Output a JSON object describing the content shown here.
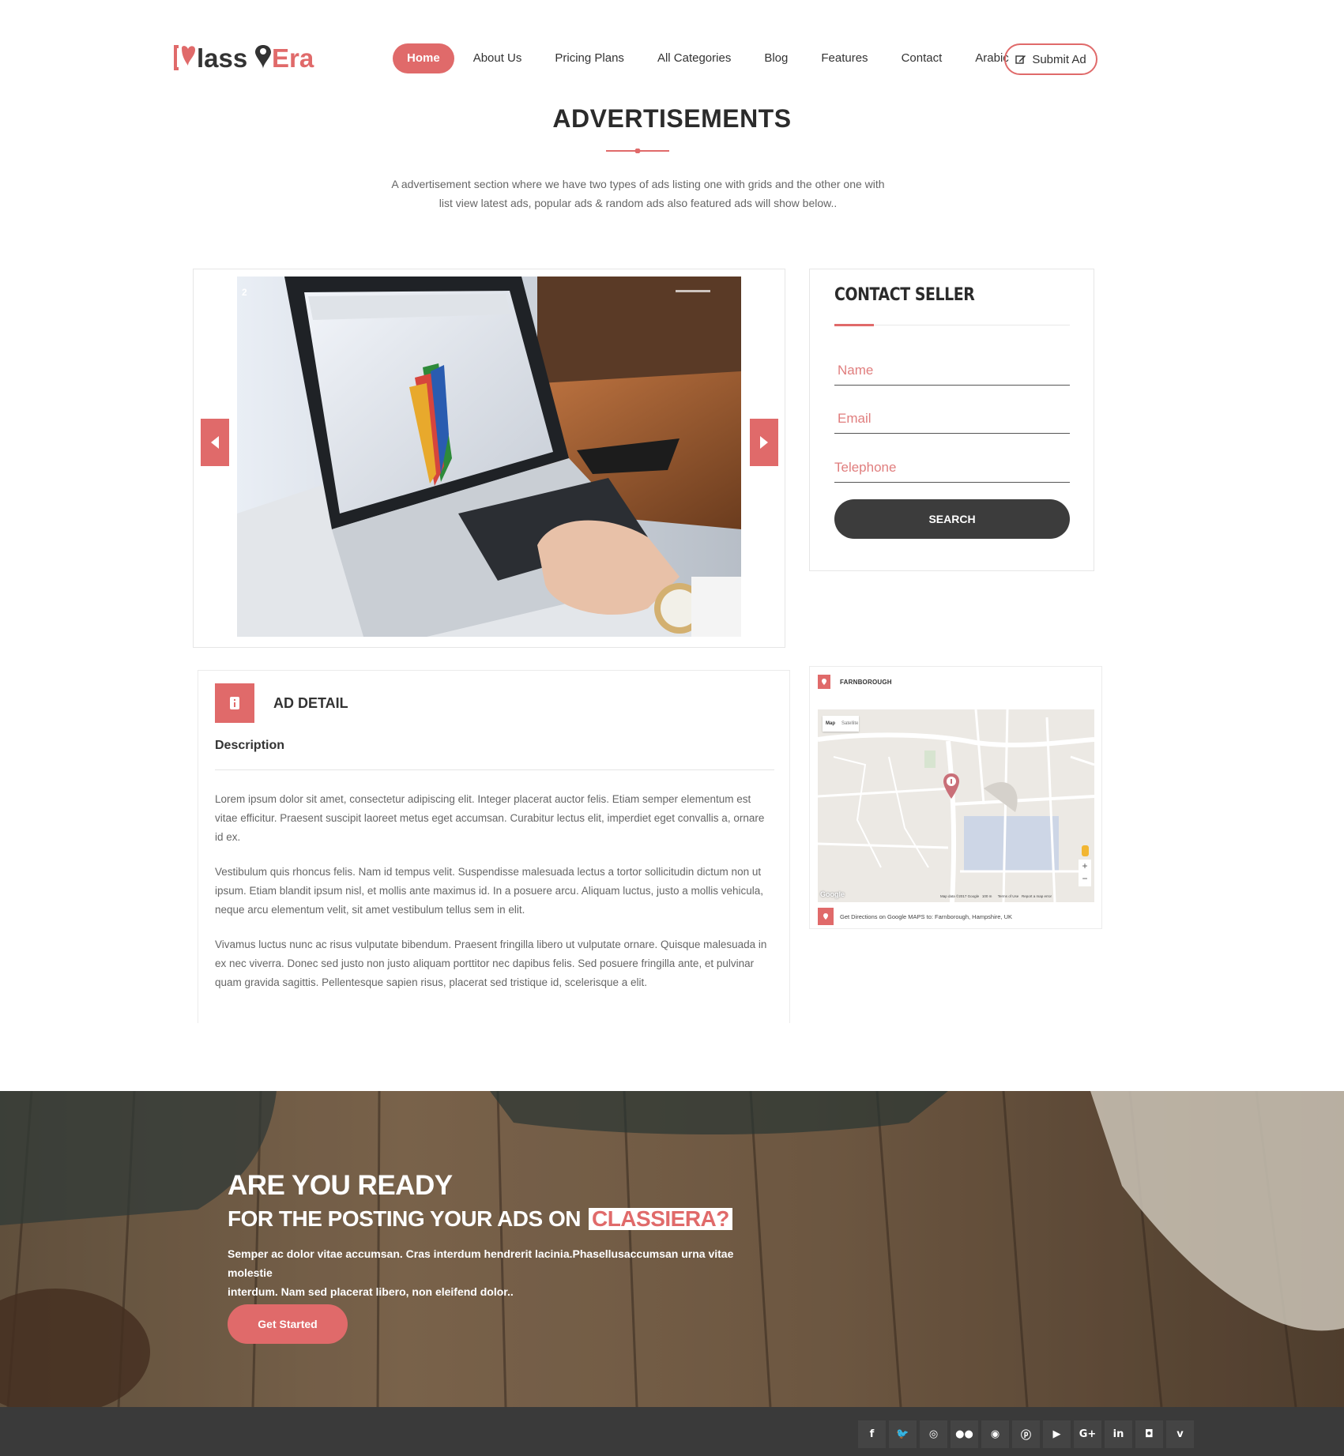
{
  "brand": {
    "logo_text": "ClassiEra",
    "accent": "#e06a6a"
  },
  "nav": {
    "items": [
      {
        "label": "Home",
        "active": true
      },
      {
        "label": "About Us"
      },
      {
        "label": "Pricing Plans"
      },
      {
        "label": "All Categories"
      },
      {
        "label": "Blog"
      },
      {
        "label": "Features"
      },
      {
        "label": "Contact"
      },
      {
        "label": "Arabic"
      }
    ],
    "submit_label": "Submit Ad",
    "submit_icon": "edit-icon"
  },
  "section": {
    "title": "ADVERTISEMENTS",
    "description_line1": "A advertisement section where we have two types of ads listing one with grids and the other one with",
    "description_line2": "list view latest ads, popular ads & random ads also featured ads will show below.."
  },
  "slider": {
    "current_slide": "2",
    "prev_icon": "triangle-left-icon",
    "next_icon": "triangle-right-icon"
  },
  "contact": {
    "title": "CONTACT SELLER",
    "name_placeholder": "Name",
    "email_placeholder": "Email",
    "telephone_placeholder": "Telephone",
    "button_label": "SEARCH"
  },
  "ad_detail": {
    "title": "AD DETAIL",
    "subtitle": "Description",
    "paragraphs": [
      "Lorem ipsum dolor sit amet, consectetur adipiscing elit. Integer placerat auctor felis. Etiam semper elementum est vitae efficitur. Praesent suscipit laoreet metus eget accumsan. Curabitur lectus elit, imperdiet eget convallis a, ornare id ex.",
      "Vestibulum quis rhoncus felis. Nam id tempus velit. Suspendisse malesuada lectus a tortor sollicitudin dictum non ut ipsum. Etiam blandit ipsum nisl, et mollis ante maximus id. In a posuere arcu. Aliquam luctus, justo a mollis vehicula, neque arcu elementum velit, sit amet vestibulum tellus sem in elit.",
      "Vivamus luctus nunc ac risus vulputate bibendum. Praesent fringilla libero ut vulputate ornare. Quisque malesuada in ex nec viverra. Donec sed justo non justo aliquam porttitor nec dapibus felis. Sed posuere fringilla ante, et pulvinar quam gravida sagittis. Pellentesque sapien risus, placerat sed tristique id, scelerisque a elit."
    ]
  },
  "map": {
    "location": "FARNBOROUGH",
    "map_tab": "Map",
    "satellite_tab": "Satellite",
    "zoom_in": "+",
    "zoom_out": "−",
    "attribution": "Google",
    "terms": "Map data ©2017 Google   100 m      Terms of Use   Report a map error",
    "directions": "Get Directions on Google MAPS to: Farnborough, Hampshire, UK"
  },
  "cta": {
    "heading1": "ARE YOU READY",
    "heading2": "FOR THE POSTING YOUR ADS ON",
    "highlight": "CLASSIERA?",
    "body_line1": "Semper ac dolor vitae accumsan. Cras interdum hendrerit lacinia.Phasellusaccumsan urna vitae molestie",
    "body_line2": "interdum. Nam sed placerat libero, non eleifend dolor..",
    "button_label": "Get Started"
  },
  "footer": {
    "socials": [
      {
        "icon": "facebook-icon",
        "glyph": "f"
      },
      {
        "icon": "twitter-icon",
        "glyph": "🐦"
      },
      {
        "icon": "dribbble-icon",
        "glyph": "◎"
      },
      {
        "icon": "flickr-icon",
        "glyph": "●●"
      },
      {
        "icon": "github-icon",
        "glyph": "◉"
      },
      {
        "icon": "pinterest-icon",
        "glyph": "ⓟ"
      },
      {
        "icon": "youtube-icon",
        "glyph": "▶"
      },
      {
        "icon": "google-plus-icon",
        "glyph": "G+"
      },
      {
        "icon": "linkedin-icon",
        "glyph": "in"
      },
      {
        "icon": "instagram-icon",
        "glyph": "◘"
      },
      {
        "icon": "vimeo-icon",
        "glyph": "v"
      }
    ]
  }
}
